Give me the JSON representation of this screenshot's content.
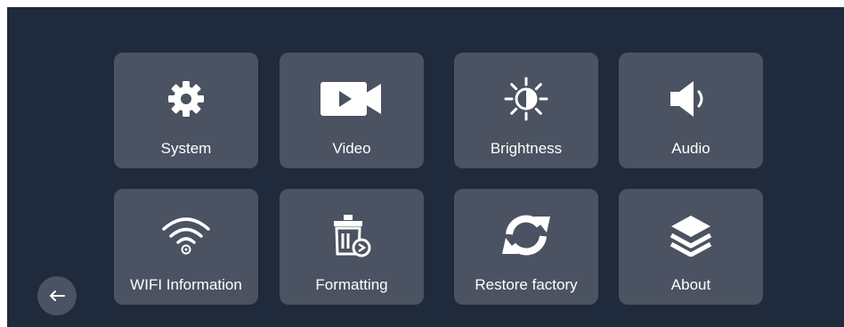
{
  "menu": {
    "tiles": [
      {
        "label": "System",
        "icon": "gear-icon"
      },
      {
        "label": "Video",
        "icon": "video-camera-icon"
      },
      {
        "label": "Brightness",
        "icon": "brightness-icon"
      },
      {
        "label": "Audio",
        "icon": "speaker-icon"
      },
      {
        "label": "WIFI Information",
        "icon": "wifi-icon"
      },
      {
        "label": "Formatting",
        "icon": "trash-format-icon"
      },
      {
        "label": "Restore factory",
        "icon": "restore-icon"
      },
      {
        "label": "About",
        "icon": "layers-icon"
      }
    ]
  },
  "nav": {
    "back_icon": "arrow-left-icon"
  },
  "colors": {
    "background": "#1f2a3c",
    "tile": "#4b5261",
    "text": "#ffffff"
  }
}
